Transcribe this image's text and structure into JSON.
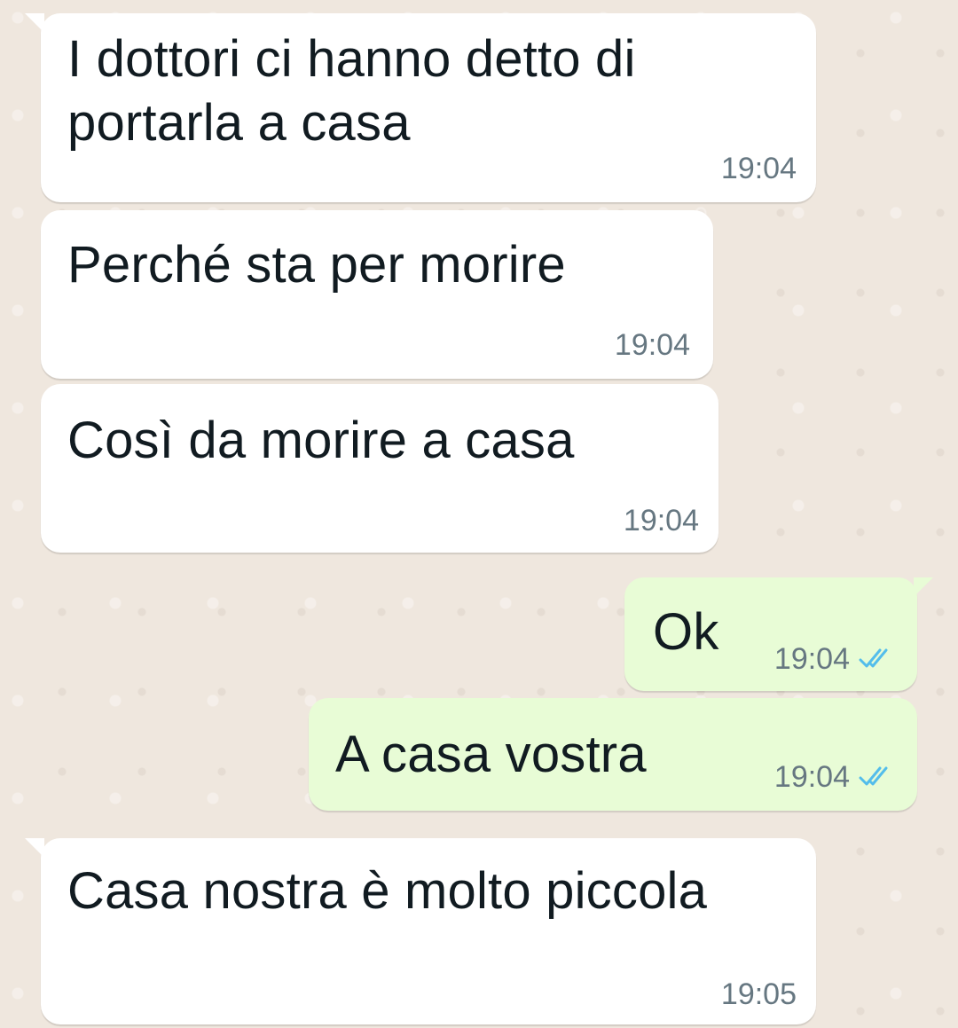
{
  "theme": {
    "incoming_bubble": "#ffffff",
    "outgoing_bubble": "#e8fcd6",
    "read_ticks": "#53bdeb",
    "timestamp": "#667781"
  },
  "messages": [
    {
      "direction": "incoming",
      "text": "I dottori ci hanno detto di portarla a casa",
      "time": "19:04"
    },
    {
      "direction": "incoming",
      "text": "Perché sta per morire",
      "time": "19:04"
    },
    {
      "direction": "incoming",
      "text": "Così da morire a casa",
      "time": "19:04"
    },
    {
      "direction": "outgoing",
      "text": "Ok",
      "time": "19:04",
      "status": "read",
      "status_icon": "double-check-icon"
    },
    {
      "direction": "outgoing",
      "text": "A casa vostra",
      "time": "19:04",
      "status": "read",
      "status_icon": "double-check-icon"
    },
    {
      "direction": "incoming",
      "text": "Casa nostra è molto piccola",
      "time": "19:05"
    }
  ]
}
